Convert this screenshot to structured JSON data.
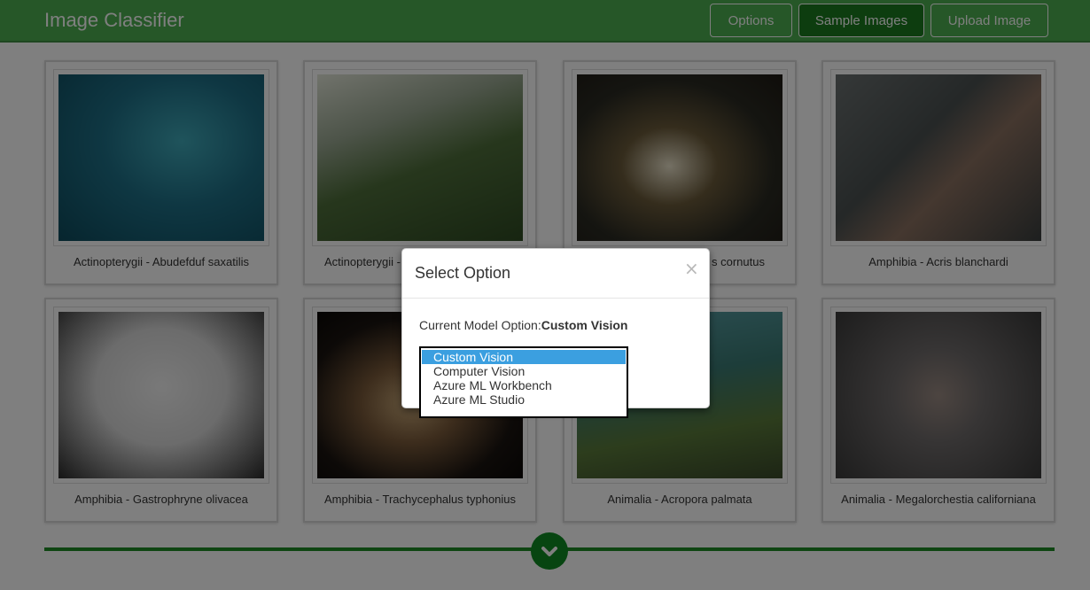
{
  "app": {
    "title": "Image Classifier"
  },
  "nav": {
    "options_label": "Options",
    "sample_images_label": "Sample Images",
    "upload_image_label": "Upload Image"
  },
  "grid": {
    "items": [
      {
        "caption": "Actinopterygii - Abudefduf saxatilis"
      },
      {
        "caption": "Actinopterygii -"
      },
      {
        "caption": "s cornutus"
      },
      {
        "caption": "Amphibia - Acris blanchardi"
      },
      {
        "caption": "Amphibia - Gastrophryne olivacea"
      },
      {
        "caption": "Amphibia - Trachycephalus typhonius"
      },
      {
        "caption": "Animalia - Acropora palmata"
      },
      {
        "caption": "Animalia - Megalorchestia californiana"
      }
    ]
  },
  "modal": {
    "title": "Select Option",
    "close_label": "×",
    "current_label": "Current Model Option:",
    "current_value": "Custom Vision"
  },
  "select": {
    "selected": "Custom Vision",
    "options": [
      {
        "label": "Custom Vision"
      },
      {
        "label": "Computer Vision"
      },
      {
        "label": "Azure ML Workbench"
      },
      {
        "label": "Azure ML Studio"
      }
    ]
  },
  "icons": {
    "scroll_down": "chevron-down-icon"
  },
  "colors": {
    "navbar": "#4caf50",
    "nav_active": "#1b7a1f",
    "separator": "#1f8a24",
    "selected_option": "#3b9fe0"
  }
}
